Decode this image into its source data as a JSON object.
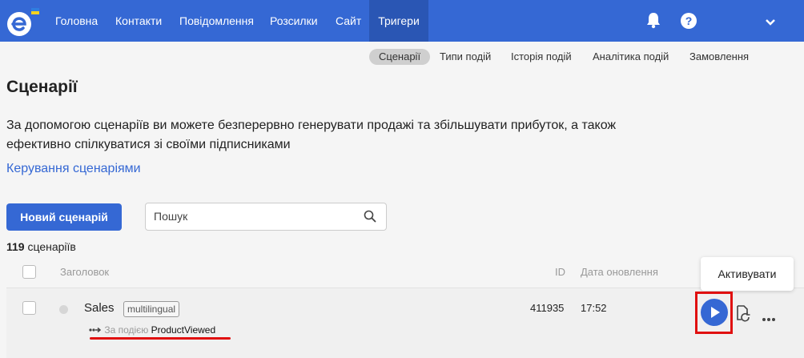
{
  "nav": {
    "items": [
      "Головна",
      "Контакти",
      "Повідомлення",
      "Розсилки",
      "Сайт",
      "Тригери"
    ],
    "active": "Тригери",
    "accent": "#3568d4",
    "icons": [
      "bell-icon",
      "help-icon",
      "chevron-down-icon"
    ]
  },
  "subtabs": {
    "items": [
      "Сценарії",
      "Типи подій",
      "Історія подій",
      "Аналітика подій",
      "Замовлення"
    ],
    "active": "Сценарії"
  },
  "page": {
    "title": "Сценарії",
    "description": "За допомогою сценаріїв ви можете безперервно генерувати продажі та збільшувати прибуток, а також ефективно спілкуватися зі своїми підписниками",
    "manage_link": "Керування сценаріями"
  },
  "toolbar": {
    "new_button": "Новий сценарій",
    "search_placeholder": "Пошук"
  },
  "count": {
    "number": "119",
    "label": "сценаріїв"
  },
  "table": {
    "columns": {
      "title": "Заголовок",
      "id": "ID",
      "updated": "Дата оновлення"
    },
    "rows": [
      {
        "title": "Sales",
        "tag": "multilingual",
        "trigger_label": "За подією",
        "trigger_event": "ProductViewed",
        "id": "411935",
        "updated": "17:52"
      }
    ]
  },
  "tooltip": "Активувати",
  "highlight_color": "#e01010"
}
